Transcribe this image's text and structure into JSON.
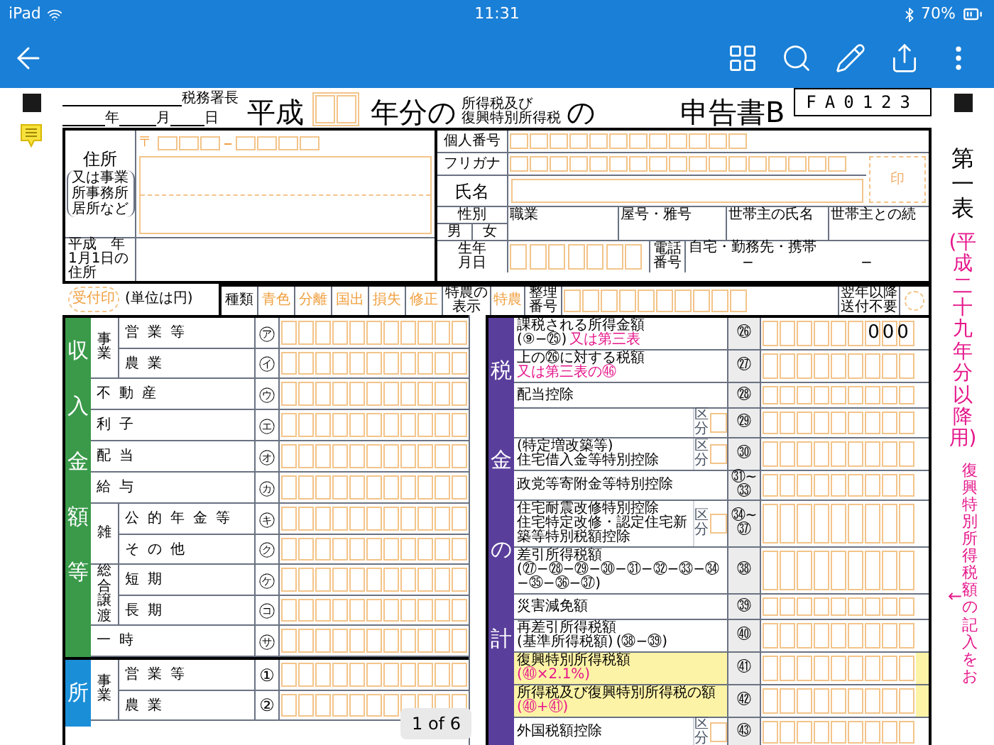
{
  "status_bar": {
    "device": "iPad",
    "time": "11:31",
    "battery": "70%"
  },
  "header": {
    "office_suffix": "税務署長",
    "date_labels": [
      "年",
      "月",
      "日"
    ],
    "era": "平成",
    "year_suffix": "年分の",
    "tax_names": [
      "所得税及び",
      "復興特別所得税"
    ],
    "particle": "の",
    "form_name": "申告書B",
    "form_code": "FA0123"
  },
  "address": {
    "label": "住所",
    "note": "又は事業所事務所居所など",
    "postal_mark": "〒",
    "jan1_label": "平成　年1月1日の住所"
  },
  "personal": {
    "number_label": "個人番号",
    "kana_label": "フリガナ",
    "name_label": "氏名",
    "seal": "印",
    "sex_label": "性別",
    "sexes": [
      "男",
      "女"
    ],
    "occupation": "職業",
    "trade_name": "屋号・雅号",
    "householder": "世帯主の氏名",
    "relation": "世帯主との続",
    "birth_label": "生年月日",
    "phone_label": "電話番号",
    "phone_kinds": "自宅・勤務先・携帯",
    "phone_dashes": [
      "−",
      "−"
    ]
  },
  "type_row": {
    "stamp": "受付印",
    "unit": "(単位は円)",
    "kinds_label": "種類",
    "kinds": [
      "青色",
      "分離",
      "国出",
      "損失",
      "修正"
    ],
    "special_label": "特農の表示",
    "special": "特農",
    "ref_label": "整理番号",
    "no_mail": "翌年以降送付不要",
    "no_mail_checked": false
  },
  "income": {
    "title": "収入金額等",
    "groups": [
      {
        "label": "事業",
        "rows": [
          {
            "label": "営業等",
            "mark": "㋐"
          },
          {
            "label": "農業",
            "mark": "㋑"
          }
        ]
      },
      {
        "rows": [
          {
            "label": "不動産",
            "mark": "㋒"
          }
        ]
      },
      {
        "rows": [
          {
            "label": "利子",
            "mark": "㋓"
          }
        ]
      },
      {
        "rows": [
          {
            "label": "配当",
            "mark": "㋔"
          }
        ]
      },
      {
        "rows": [
          {
            "label": "給与",
            "mark": "㋕"
          }
        ]
      },
      {
        "label": "雑",
        "rows": [
          {
            "label": "公的年金等",
            "mark": "㋖"
          },
          {
            "label": "その他",
            "mark": "㋗"
          }
        ]
      },
      {
        "label": "総合譲渡",
        "rows": [
          {
            "label": "短期",
            "mark": "㋘"
          },
          {
            "label": "長期",
            "mark": "㋙"
          }
        ]
      },
      {
        "rows": [
          {
            "label": "一時",
            "mark": "㋚"
          }
        ]
      }
    ]
  },
  "income_calc": {
    "title": "所",
    "groups": [
      {
        "label": "事業",
        "rows": [
          {
            "label": "営業等",
            "mark": "①"
          },
          {
            "label": "農業",
            "mark": "②"
          }
        ]
      }
    ]
  },
  "tax": {
    "title": "税金の計",
    "rows": [
      {
        "mark": "㉖",
        "label": "課税される所得金額",
        "lines": [
          {
            "text": "(⑨−㉕)",
            "kind": "plain"
          },
          {
            "text": "又は第三表",
            "kind": "alert"
          }
        ],
        "printed": "000",
        "highlight": false
      },
      {
        "mark": "㉗",
        "label": "上の㉖に対する税額",
        "lines": [
          {
            "text": "又は第三表の㊻",
            "kind": "alert"
          }
        ],
        "highlight": false
      },
      {
        "mark": "㉘",
        "label": "配当控除",
        "highlight": false
      },
      {
        "mark": "㉙",
        "kubun": "区分",
        "highlight": false
      },
      {
        "mark": "㉚",
        "label": "(特定増改築等)",
        "lines": [
          {
            "text": "住宅借入金等特別控除",
            "kind": "plain"
          }
        ],
        "kubun": "区分",
        "highlight": false
      },
      {
        "mark": "㉛~㉝",
        "label": "政党等寄附金等特別控除",
        "highlight": false
      },
      {
        "mark": "㉞~㊲",
        "label": "住宅耐震改修特別控除",
        "lines": [
          {
            "text": "住宅特定改修・認定住宅新築等特別税額控除",
            "kind": "plain"
          }
        ],
        "kubun": "区分",
        "highlight": false
      },
      {
        "mark": "㊳",
        "label": "差引所得税額",
        "lines": [
          {
            "text": "(㉗−㉘−㉙−㉚−㉛−㉜−㉝−㉞−㉟−㊱−㊲)",
            "kind": "plain"
          }
        ],
        "highlight": false
      },
      {
        "mark": "㊴",
        "label": "災害減免額",
        "highlight": false
      },
      {
        "mark": "㊵",
        "label": "再差引所得税額",
        "lines": [
          {
            "text": "(基準所得税額)",
            "kind": "plain"
          },
          {
            "text": "(㊳−㊴)",
            "kind": "plain"
          }
        ],
        "highlight": false
      },
      {
        "mark": "㊶",
        "label": "復興特別所得税額",
        "lines": [
          {
            "text": "(㊵×2.1%)",
            "kind": "alert"
          }
        ],
        "highlight": true
      },
      {
        "mark": "㊷",
        "label": "所得税及び復興特別所得税の額",
        "lines": [
          {
            "text": "(㊵+㊶)",
            "kind": "alert"
          }
        ],
        "highlight": true
      },
      {
        "mark": "㊸",
        "label": "外国税額控除",
        "kubun": "区分",
        "highlight": false
      }
    ]
  },
  "side": {
    "table_title": "第一表",
    "edition": "(平成二十九年分以降用)",
    "reminder": "復興特別所得税額の記入をお",
    "arrow": "←"
  },
  "pager": "1 of 6"
}
